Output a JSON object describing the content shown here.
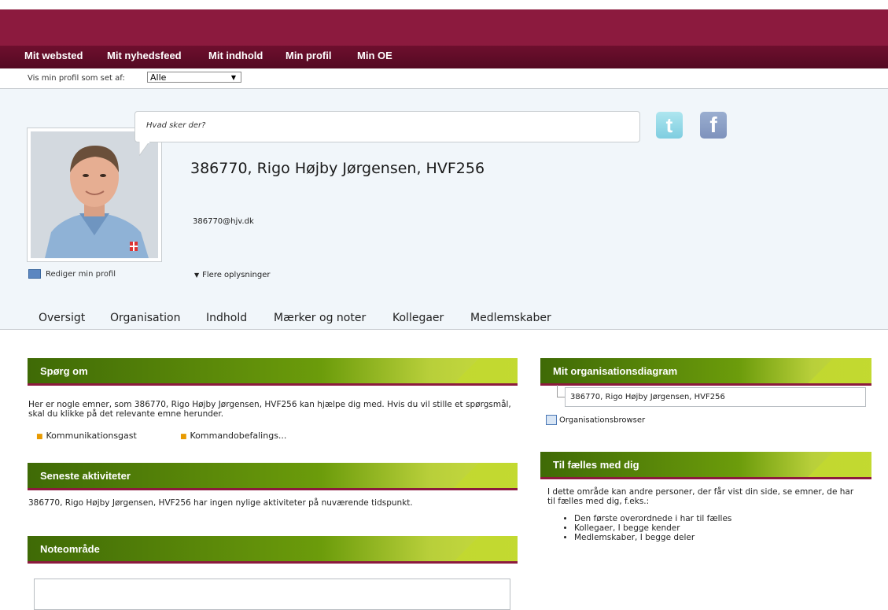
{
  "nav": {
    "items": [
      {
        "label": "Mit websted"
      },
      {
        "label": "Mit nyhedsfeed"
      },
      {
        "label": "Mit indhold"
      },
      {
        "label": "Min profil"
      },
      {
        "label": "Min OE"
      }
    ]
  },
  "view_as": {
    "label": "Vis min profil som set af:",
    "selected": "Alle"
  },
  "status": {
    "placeholder": "Hvad sker der?"
  },
  "social": {
    "twitter_icon": "twitter-icon",
    "facebook_icon": "facebook-icon",
    "twitter_glyph": "t",
    "facebook_glyph": "f"
  },
  "profile": {
    "name": "386770, Rigo Højby Jørgensen, HVF256",
    "email": "386770@hjv.dk",
    "edit_label": "Rediger min profil",
    "more_info_label": "Flere oplysninger"
  },
  "tabs": [
    {
      "label": "Oversigt"
    },
    {
      "label": "Organisation"
    },
    {
      "label": "Indhold"
    },
    {
      "label": "Mærker og noter"
    },
    {
      "label": "Kollegaer"
    },
    {
      "label": "Medlemskaber"
    }
  ],
  "ask_about": {
    "title": "Spørg om",
    "description": "Her er nogle emner, som 386770, Rigo Højby Jørgensen, HVF256 kan hjælpe dig med. Hvis du vil stille et spørgsmål, skal du klikke på det relevante emne herunder.",
    "topics": [
      {
        "label": "Kommunikationsgast"
      },
      {
        "label": "Kommandobefalings..."
      }
    ]
  },
  "recent_activity": {
    "title": "Seneste aktiviteter",
    "text": "386770, Rigo Højby Jørgensen, HVF256 har ingen nylige aktiviteter på nuværende tidspunkt."
  },
  "note_area": {
    "title": "Noteområde"
  },
  "org_chart": {
    "title": "Mit organisationsdiagram",
    "node": "386770, Rigo Højby Jørgensen, HVF256",
    "browser_label": "Organisationsbrowser"
  },
  "in_common": {
    "title": "Til fælles med dig",
    "description": "I dette område kan andre personer, der får vist din side, se emner, de har til fælles med dig, f.eks.:",
    "items": [
      {
        "label": "Den første overordnede i har til fælles"
      },
      {
        "label": "Kollegaer, I begge kender"
      },
      {
        "label": "Medlemskaber, I begge deler"
      }
    ]
  },
  "colors": {
    "brand": "#8c1a3e",
    "header_green": "#6c9c0b",
    "bullet": "#e89a00"
  }
}
